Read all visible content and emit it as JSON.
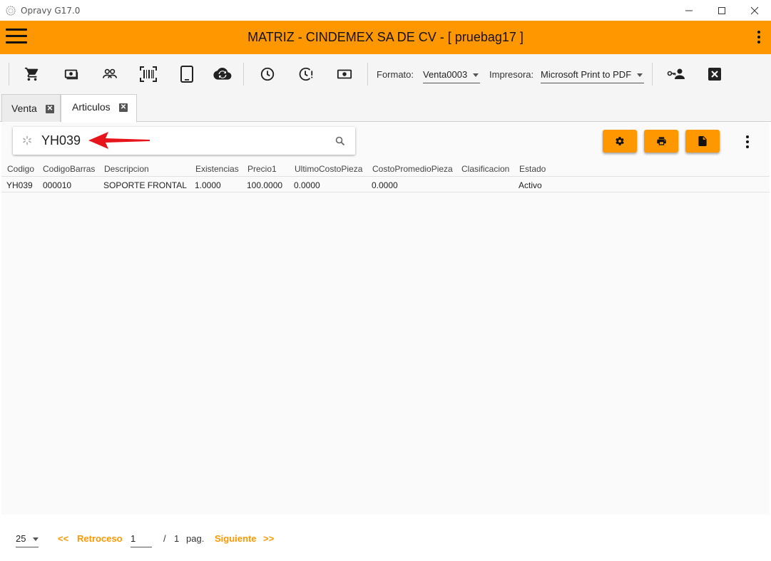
{
  "window": {
    "title": "Opravy G17.0"
  },
  "header": {
    "title": "MATRIZ - CINDEMEX SA DE CV - [ pruebag17 ]"
  },
  "toolbar": {
    "icons": [
      "cart-icon",
      "cash-icon",
      "people-icon",
      "barcode-icon",
      "tablet-icon",
      "cloud-sync-icon",
      "clock-icon",
      "clock-alert-icon",
      "cash-box-icon"
    ],
    "formato_label": "Formato:",
    "formato_value": "Venta0003",
    "impresora_label": "Impresora:",
    "impresora_value": "Microsoft Print to PDF"
  },
  "tabs": [
    {
      "label": "Venta",
      "active": false
    },
    {
      "label": "Articulos",
      "active": true
    }
  ],
  "search": {
    "value": "YH039"
  },
  "table": {
    "columns": [
      "Codigo",
      "CodigoBarras",
      "Descripcion",
      "Existencias",
      "Precio1",
      "UltimoCostoPieza",
      "CostoPromedioPieza",
      "Clasificacion",
      "Estado"
    ],
    "rows": [
      [
        "YH039",
        "000010",
        "SOPORTE FRONTAL",
        "1.0000",
        "100.0000",
        "0.0000",
        "0.0000",
        "",
        "Activo"
      ]
    ]
  },
  "pager": {
    "page_size": "25",
    "prev_arrows": "<<",
    "prev_label": "Retroceso",
    "current_page": "1",
    "separator": "/",
    "total_pages": "1",
    "pag_label": "pag.",
    "next_label": "Siguiente",
    "next_arrows": ">>"
  },
  "colors": {
    "accent": "#ff9800",
    "arrow": "#e8141b"
  }
}
